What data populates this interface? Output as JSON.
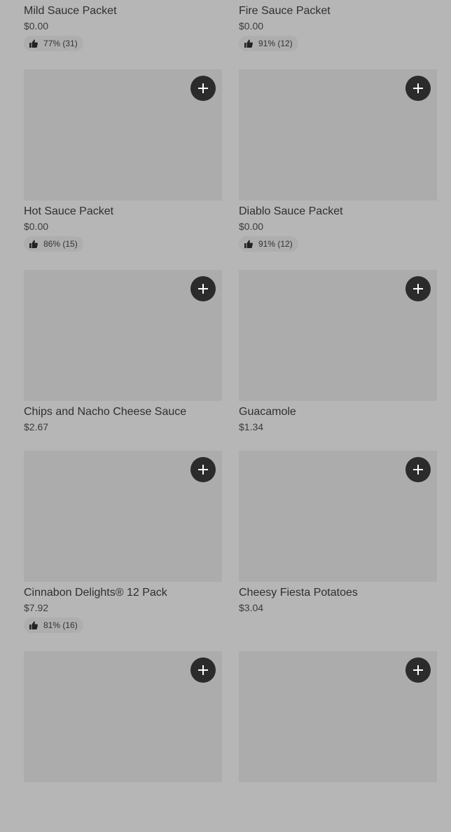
{
  "colors": {
    "background": "#b6b6b6",
    "image_placeholder": "#acacac",
    "add_button": "#2b2b2b",
    "rating_pill": "#aeaeae",
    "text": "#2f2f2f"
  },
  "icons": {
    "add": "plus-icon",
    "rating": "thumbs-up-icon"
  },
  "items": [
    {
      "name": "Mild Sauce Packet",
      "price": "$0.00",
      "rating": "77% (31)"
    },
    {
      "name": "Fire Sauce Packet",
      "price": "$0.00",
      "rating": "91% (12)"
    },
    {
      "name": "Hot Sauce Packet",
      "price": "$0.00",
      "rating": "86% (15)"
    },
    {
      "name": "Diablo Sauce Packet",
      "price": "$0.00",
      "rating": "91% (12)"
    },
    {
      "name": "Chips and Nacho Cheese Sauce",
      "price": "$2.67",
      "rating": null
    },
    {
      "name": "Guacamole",
      "price": "$1.34",
      "rating": null
    },
    {
      "name": "Cinnabon Delights® 12 Pack",
      "price": "$7.92",
      "rating": "81% (16)"
    },
    {
      "name": "Cheesy Fiesta Potatoes",
      "price": "$3.04",
      "rating": null
    },
    {
      "name": "",
      "price": "",
      "rating": null
    },
    {
      "name": "",
      "price": "",
      "rating": null
    }
  ]
}
